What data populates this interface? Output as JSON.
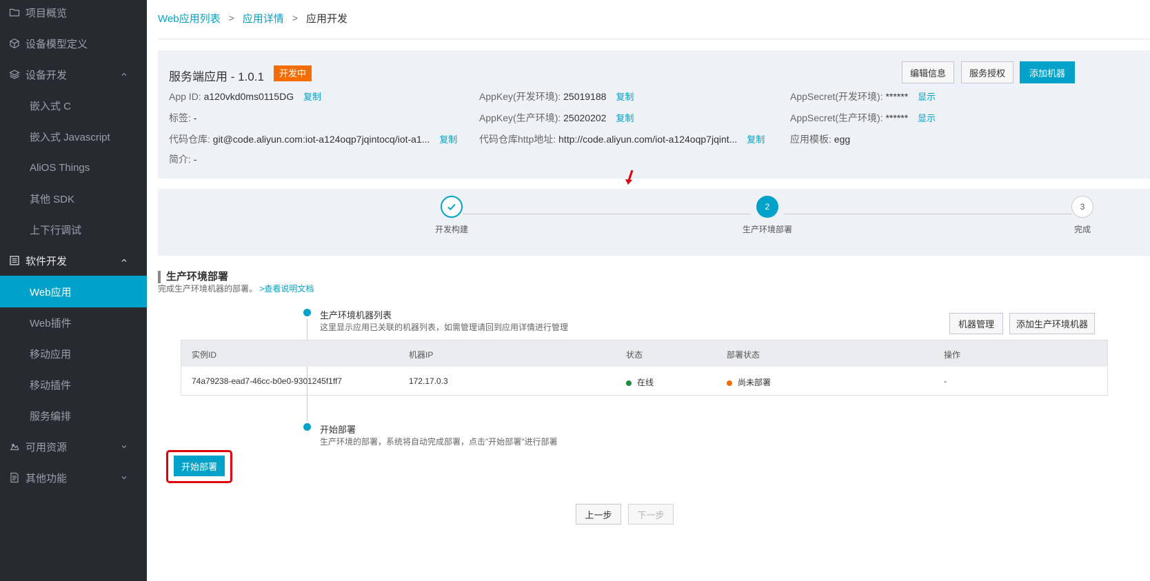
{
  "sidebar": {
    "items": [
      {
        "label": "项目概览",
        "icon": "folder-icon"
      },
      {
        "label": "设备模型定义",
        "icon": "cube-icon"
      },
      {
        "label": "设备开发",
        "icon": "layers-icon"
      },
      {
        "label": "嵌入式 C"
      },
      {
        "label": "嵌入式 Javascript"
      },
      {
        "label": "AliOS Things"
      },
      {
        "label": "其他 SDK"
      },
      {
        "label": "上下行调试"
      },
      {
        "label": "软件开发",
        "icon": "list-icon"
      },
      {
        "label": "Web应用"
      },
      {
        "label": "Web插件"
      },
      {
        "label": "移动应用"
      },
      {
        "label": "移动插件"
      },
      {
        "label": "服务编排"
      },
      {
        "label": "可用资源",
        "icon": "resource-icon"
      },
      {
        "label": "其他功能",
        "icon": "document-icon"
      }
    ]
  },
  "breadcrumb": {
    "items": [
      "Web应用列表",
      "应用详情",
      "应用开发"
    ],
    "sep": ">"
  },
  "app": {
    "title": "服务端应用 - 1.0.1",
    "badge": "开发中",
    "buttons": {
      "edit": "编辑信息",
      "auth": "服务授权",
      "add_machine": "添加机器"
    },
    "copy": "复制",
    "show": "显示",
    "app_id_label": "App ID:",
    "app_id": "a120vkd0ms0115DG",
    "appkey_dev_label": "AppKey(开发环境):",
    "appkey_dev": "25019188",
    "appsecret_dev_label": "AppSecret(开发环境):",
    "appsecret_dev": "******",
    "tag_label": "标签:",
    "tag": "-",
    "appkey_prod_label": "AppKey(生产环境):",
    "appkey_prod": "25020202",
    "appsecret_prod_label": "AppSecret(生产环境):",
    "appsecret_prod": "******",
    "repo_label": "代码仓库:",
    "repo": "git@code.aliyun.com:iot-a124oqp7jqintocq/iot-a1...",
    "repo_http_label": "代码仓库http地址:",
    "repo_http": "http://code.aliyun.com/iot-a124oqp7jqint...",
    "template_label": "应用模板:",
    "template": "egg",
    "intro_label": "简介:",
    "intro": "-"
  },
  "steps": [
    {
      "label": "开发构建",
      "state": "done"
    },
    {
      "label": "生产环境部署",
      "num": "2",
      "state": "active"
    },
    {
      "label": "完成",
      "num": "3",
      "state": "pending"
    }
  ],
  "section": {
    "title": "生产环境部署",
    "desc": "完成生产环境机器的部署。",
    "doc_link": ">查看说明文档"
  },
  "machines": {
    "title": "生产环境机器列表",
    "desc": "这里显示应用已关联的机器列表，如需管理请回到应用详情进行管理",
    "manage_btn": "机器管理",
    "add_btn": "添加生产环境机器",
    "columns": [
      "实例ID",
      "机器IP",
      "状态",
      "部署状态",
      "操作"
    ],
    "rows": [
      {
        "id": "74a79238-ead7-46cc-b0e0-9301245f1ff7",
        "ip": "172.17.0.3",
        "status": "在线",
        "status_color": "#1e8e3e",
        "deploy": "尚未部署",
        "deploy_color": "#f56c00",
        "op": "-"
      }
    ]
  },
  "deploy": {
    "title": "开始部署",
    "desc": "生产环境的部署，系统将自动完成部署，点击\"开始部署\"进行部署",
    "button": "开始部署"
  },
  "footer": {
    "prev": "上一步",
    "next": "下一步"
  },
  "colors": {
    "accent": "#00a2ca",
    "sidebar_bg": "#272b30",
    "badge": "#f56c00",
    "highlight": "#e0000a"
  }
}
